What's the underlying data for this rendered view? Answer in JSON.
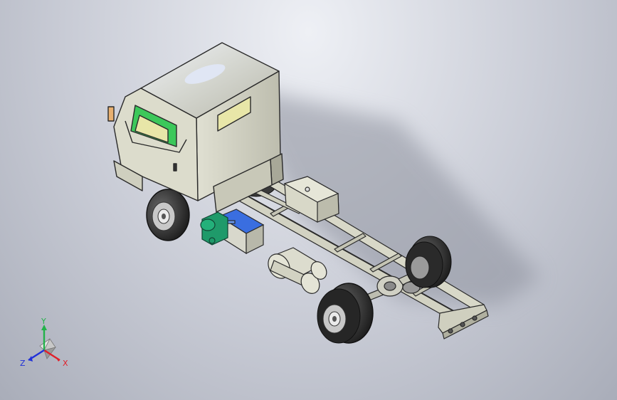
{
  "viewport": {
    "model": "truck-chassis",
    "background_top": "#eef0f5",
    "background_bottom": "#a9adb9"
  },
  "colors": {
    "body": "#d8d8c8",
    "frame": "#cfcfbf",
    "outline": "#2a2a2a",
    "glass": "#e8e6a8",
    "green_glass": "#3cc85a",
    "battery_blue": "#3a6ee0",
    "pump_green": "#1f9a6a",
    "tire": "#2b2b2b",
    "rim": "#c4c4c4"
  },
  "triad": {
    "x_label": "X",
    "y_label": "Y",
    "z_label": "Z",
    "x_color": "#e0202a",
    "y_color": "#22b24a",
    "z_color": "#2030d8"
  }
}
